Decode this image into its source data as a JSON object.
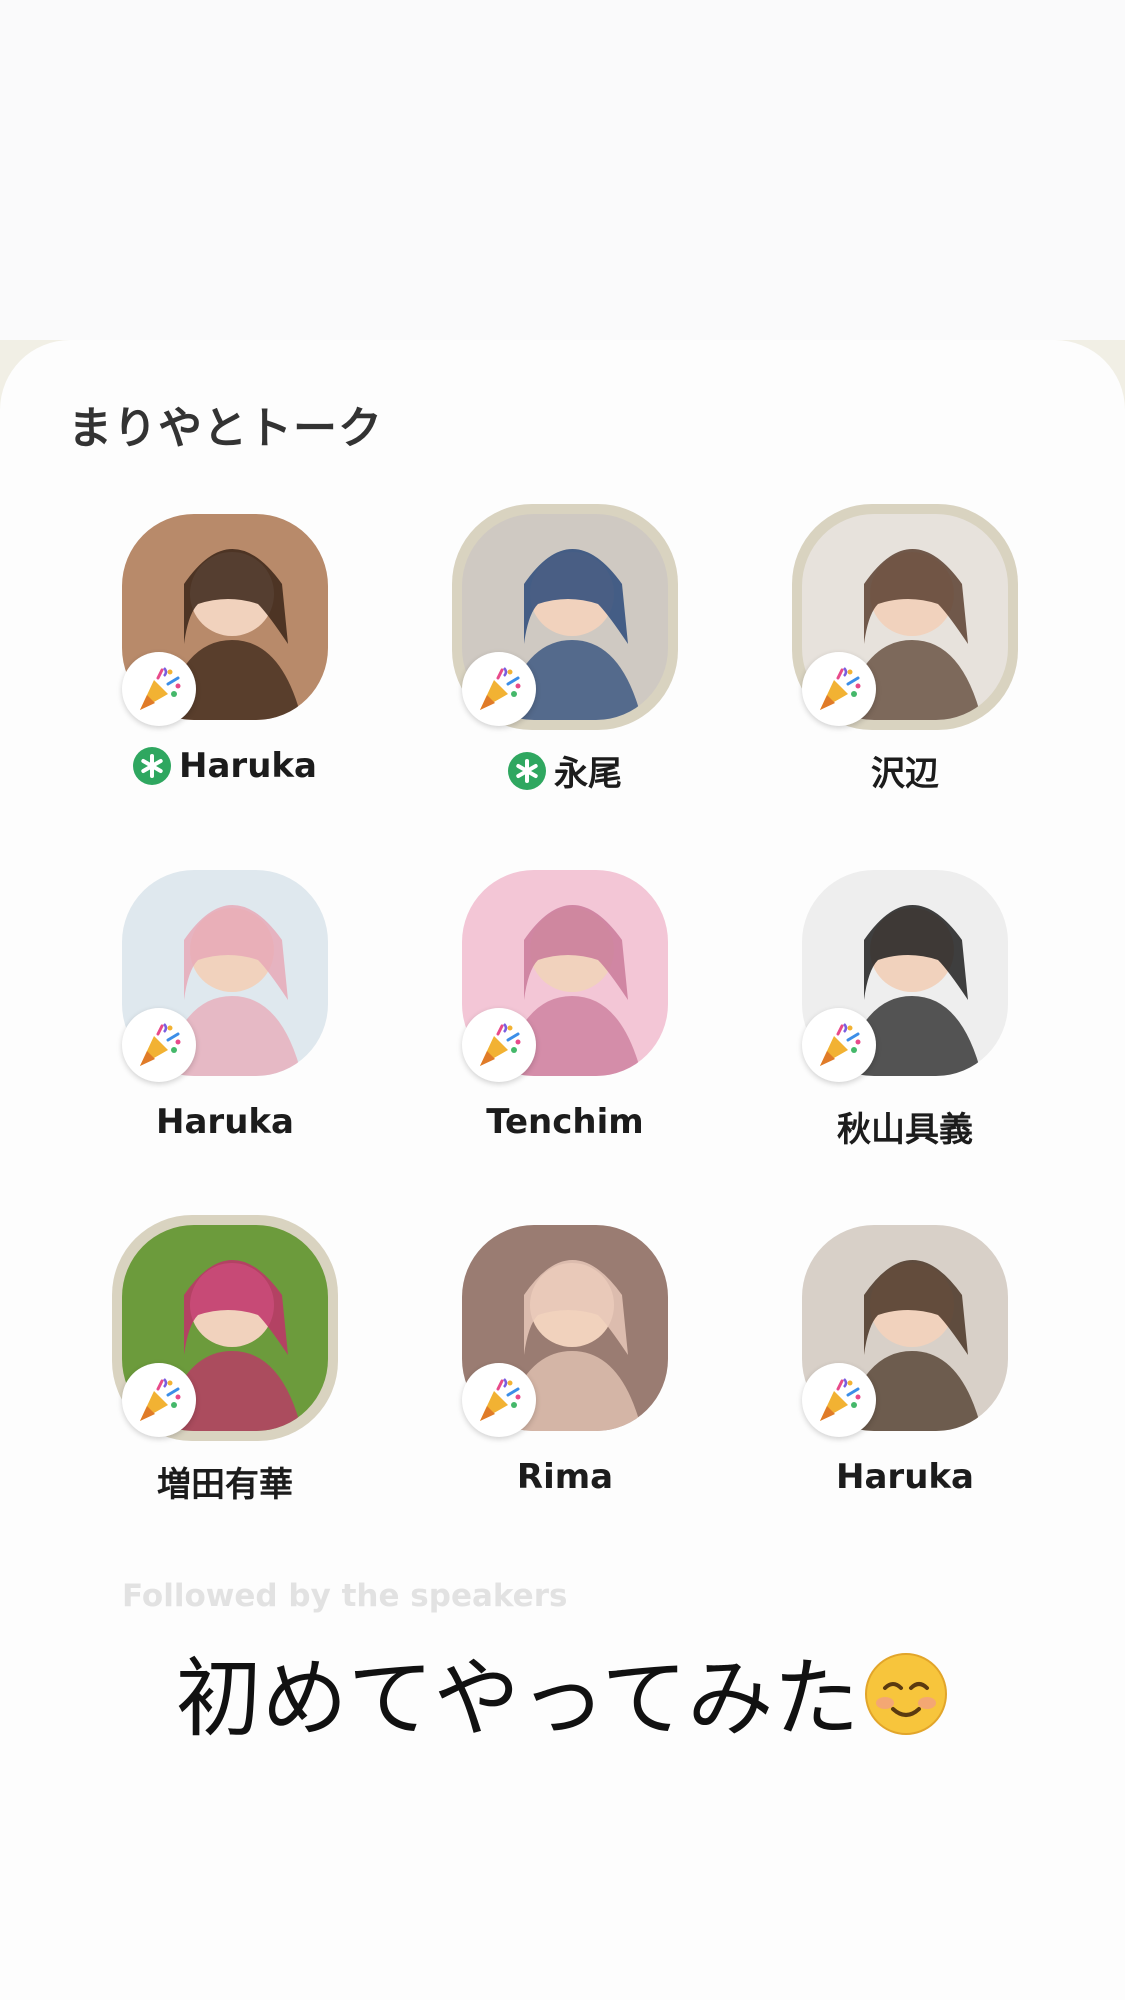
{
  "room": {
    "title": "まりやとトーク"
  },
  "speakers": [
    {
      "name": "Haruka",
      "moderator": true,
      "ring": false,
      "bg": "#b88a6a",
      "fg": "#3a2418"
    },
    {
      "name": "永尾",
      "moderator": true,
      "ring": true,
      "bg": "#cfc9c2",
      "fg": "#2b4a7a"
    },
    {
      "name": "沢辺",
      "moderator": false,
      "ring": true,
      "bg": "#e7e2dc",
      "fg": "#5a4030"
    },
    {
      "name": "Haruka",
      "moderator": false,
      "ring": false,
      "bg": "#dfe8ee",
      "fg": "#e8a9b7"
    },
    {
      "name": "Tenchim",
      "moderator": false,
      "ring": false,
      "bg": "#f3c6d6",
      "fg": "#c97a9a"
    },
    {
      "name": "秋山具義",
      "moderator": false,
      "ring": false,
      "bg": "#eeeeee",
      "fg": "#1f1f1f"
    },
    {
      "name": "増田有華",
      "moderator": false,
      "ring": true,
      "bg": "#6c9b3c",
      "fg": "#c0326a"
    },
    {
      "name": "Rima",
      "moderator": false,
      "ring": false,
      "bg": "#9a7c72",
      "fg": "#e7c8b8"
    },
    {
      "name": "Haruka",
      "moderator": false,
      "ring": false,
      "bg": "#d8d0c8",
      "fg": "#4a3526"
    }
  ],
  "followed_label": "Followed by the speakers",
  "caption": "初めてやってみた",
  "caption_emoji": "☺️",
  "colors": {
    "moderator_green": "#2fa760",
    "ring": "#d9d3c0",
    "beige": "#f1efe5"
  },
  "icons": {
    "badge": "party-popper-icon",
    "moderator": "asterisk-icon"
  }
}
